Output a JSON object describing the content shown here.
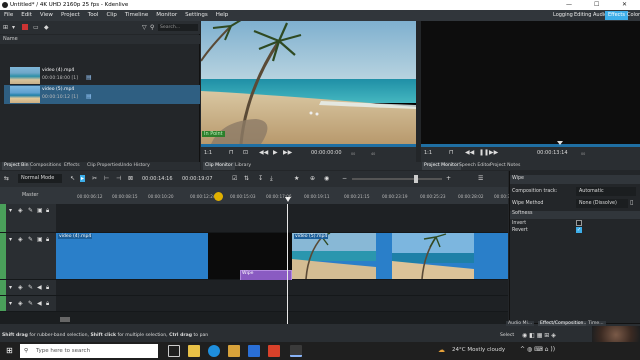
{
  "window": {
    "title": "Untitled* / 4K UHD 2160p 25 fps - Kdenlive",
    "minimize": "—",
    "maximize": "☐",
    "close": "✕"
  },
  "menu": [
    "File",
    "Edit",
    "View",
    "Project",
    "Tool",
    "Clip",
    "Timeline",
    "Monitor",
    "Settings",
    "Help"
  ],
  "workspaces": [
    "Logging",
    "Editing",
    "Audio",
    "Effects",
    "Color"
  ],
  "active_workspace": "Effects",
  "bin": {
    "search_placeholder": "Search...",
    "column_header": "Name",
    "clips": [
      {
        "name": "video (4).mp4",
        "duration": "00:00:18:00 [1]"
      },
      {
        "name": "video (5).mp4",
        "duration": "00:00:10:12 [1]"
      }
    ],
    "tabs": [
      "Project Bin",
      "Compositions",
      "Effects",
      "Clip Properties",
      "Undo History"
    ],
    "active_tab": "Project Bin"
  },
  "clip_monitor": {
    "in_point_label": "In Point",
    "zoom": "1:1",
    "timecode": "00:00:00:00",
    "ruler_ticks": [
      "00",
      "40",
      "00:00:01:12",
      "00:00:02:24",
      "00:00:04:08",
      "00:00:05:20",
      "00:00:07:16"
    ]
  },
  "project_monitor": {
    "zoom": "1:1",
    "timecode": "00:00:13:14",
    "ruler_ticks": [
      "00",
      "00:00:02:20",
      "00:00:05:16",
      "00:00:08:12",
      "00:00:11:08",
      "00:00:14:04",
      "00:00:17"
    ]
  },
  "monitor_tabs": {
    "left": [
      "Clip Monitor",
      "Library"
    ],
    "right": [
      "Project Monitor",
      "Speech Editor",
      "Project Notes"
    ],
    "active_left": "Clip Monitor",
    "active_right": "Project Monitor"
  },
  "timeline": {
    "mode": "Normal Mode",
    "timecode": "00:00:14:16",
    "duration": "00:00:19:07",
    "master_label": "Master",
    "ruler": [
      "00:00:06:12",
      "00:00:08:15",
      "00:00:10:20",
      "00:00:12:24",
      "00:00:15:03",
      "00:00:17:06",
      "00:00:19:11",
      "00:00:21:15",
      "00:00:23:19",
      "00:00:25:23",
      "00:00:28:02",
      "00:00:30:0"
    ],
    "clips": [
      {
        "label": "video (4).mp4"
      },
      {
        "label": "video (5).mp4"
      }
    ],
    "transition_label": "Wipe"
  },
  "effect_panel": {
    "title": "Wipe",
    "composition_track_label": "Composition track:",
    "composition_track_value": "Automatic",
    "wipe_method_label": "Wipe Method",
    "wipe_method_value": "None (Dissolve)",
    "softness_label": "Softness",
    "softness_value": "0",
    "invert_label": "Invert",
    "revert_label": "Revert",
    "tabs": [
      "Audio Mi...",
      "Effect/Composition...",
      "Time..."
    ]
  },
  "status": {
    "hint_bold1": "Shift drag",
    "hint1": " for rubber-band selection, ",
    "hint_bold2": "Shift click",
    "hint2": " for multiple selection, ",
    "hint_bold3": "Ctrl drag",
    "hint3": " to pan",
    "select_label": "Select"
  },
  "taskbar": {
    "search_placeholder": "Type here to search",
    "weather": "24°C  Mostly cloudy"
  },
  "colors": {
    "accent": "#3daee9",
    "video_clip": "#2a7fc9",
    "transition": "#8a5bc2",
    "track_green": "#4aa05a"
  }
}
